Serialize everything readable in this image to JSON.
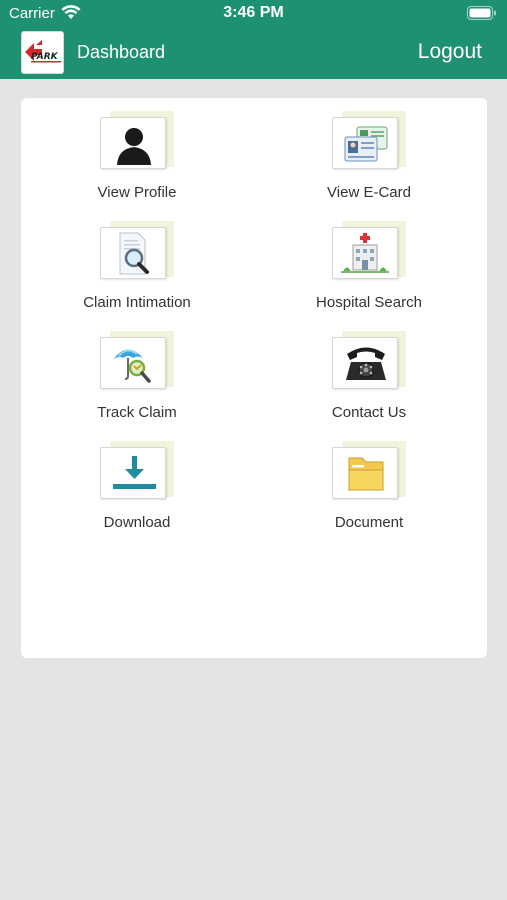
{
  "status_bar": {
    "carrier": "Carrier",
    "time": "3:46 PM"
  },
  "header": {
    "title": "Dashboard",
    "logout_label": "Logout",
    "logo_text": "PARK"
  },
  "colors": {
    "header_bg": "#1e9172",
    "page_bg": "#e4e4e4",
    "card_bg": "#ffffff"
  },
  "tiles": [
    {
      "label": "View Profile",
      "icon": "profile-icon"
    },
    {
      "label": "View E-Card",
      "icon": "ecard-icon"
    },
    {
      "label": "Claim Intimation",
      "icon": "claim-doc-icon"
    },
    {
      "label": "Hospital Search",
      "icon": "hospital-icon"
    },
    {
      "label": "Track Claim",
      "icon": "umbrella-search-icon"
    },
    {
      "label": "Contact Us",
      "icon": "telephone-icon"
    },
    {
      "label": "Download",
      "icon": "download-icon"
    },
    {
      "label": "Document",
      "icon": "folder-icon"
    }
  ]
}
